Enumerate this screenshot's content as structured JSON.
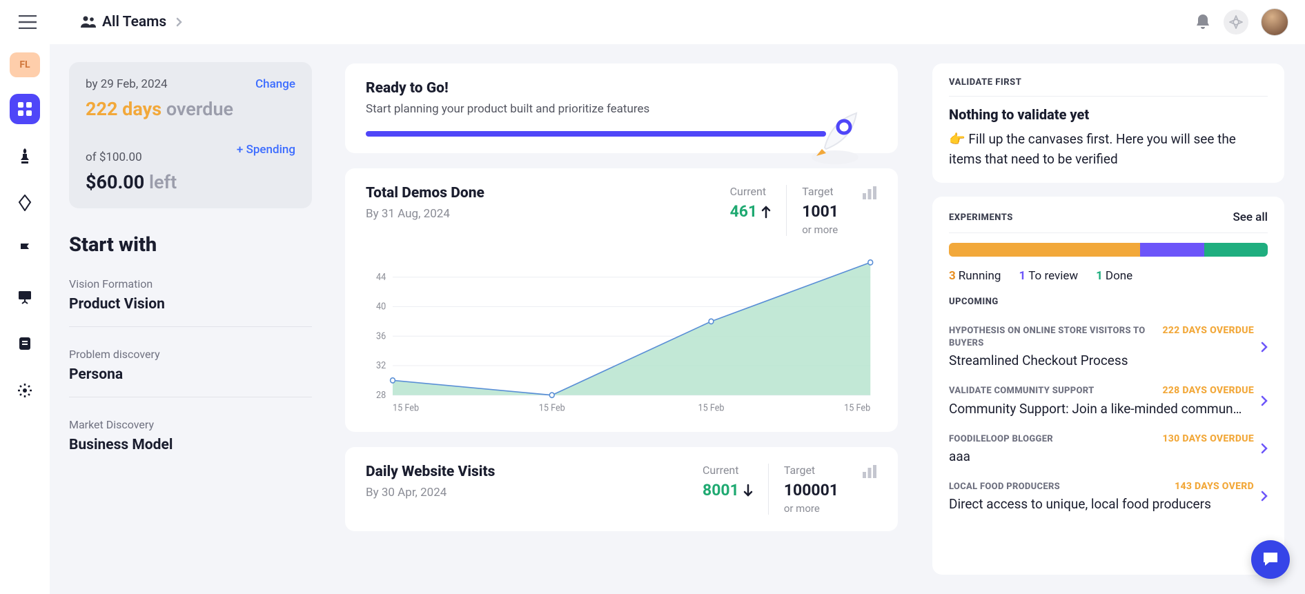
{
  "topbar": {
    "teams_label": "All Teams",
    "workspace_initials": "FL"
  },
  "budget": {
    "by_date": "by 29 Feb, 2024",
    "change_label": "Change",
    "overdue_days": "222 days ",
    "overdue_word": "overdue",
    "of_line": "of $100.00",
    "spending_label": "+ Spending",
    "left_amount": "$60.00 ",
    "left_word": "left"
  },
  "start_with": {
    "heading": "Start with",
    "groups": [
      {
        "label": "Vision Formation",
        "title": "Product Vision"
      },
      {
        "label": "Problem discovery",
        "title": "Persona"
      },
      {
        "label": "Market Discovery",
        "title": "Business Model"
      }
    ]
  },
  "ready": {
    "title": "Ready to Go!",
    "subtitle": "Start planning your product built and prioritize features"
  },
  "metric1": {
    "title": "Total Demos Done",
    "by": "By 31 Aug, 2024",
    "current_label": "Current",
    "current_value": "461",
    "target_label": "Target",
    "target_value": "1001",
    "target_note": "or more"
  },
  "metric2": {
    "title": "Daily Website Visits",
    "by": "By 30 Apr, 2024",
    "current_label": "Current",
    "current_value": "8001",
    "target_label": "Target",
    "target_value": "100001",
    "target_note": "or more"
  },
  "validate": {
    "section": "VALIDATE FIRST",
    "title": "Nothing to validate yet",
    "body": "👉 Fill up the canvases first. Here you will see the items that need to be verified"
  },
  "experiments": {
    "section": "EXPERIMENTS",
    "see_all": "See all",
    "segments": [
      {
        "color": "#f2a83a",
        "pct": 60
      },
      {
        "color": "#6c55f9",
        "pct": 20
      },
      {
        "color": "#1fae7f",
        "pct": 20
      }
    ],
    "legend": [
      {
        "n": "3",
        "label": "Running",
        "cls": "n-orange"
      },
      {
        "n": "1",
        "label": "To review",
        "cls": "n-purple"
      },
      {
        "n": "1",
        "label": "Done",
        "cls": "n-green"
      }
    ],
    "upcoming_label": "UPCOMING",
    "upcoming": [
      {
        "cat": "HYPOTHESIS ON ONLINE STORE VISITORS TO BUYERS",
        "due": "222 DAYS OVERDUE",
        "title": "Streamlined Checkout Process"
      },
      {
        "cat": "VALIDATE COMMUNITY SUPPORT",
        "due": "228 DAYS OVERDUE",
        "title": "Community Support: Join a like-minded commun…"
      },
      {
        "cat": "FOODILELOOP BLOGGER",
        "due": "130 DAYS OVERDUE",
        "title": "aaa"
      },
      {
        "cat": "LOCAL FOOD PRODUCERS",
        "due": "143 DAYS OVERD",
        "title": "Direct access to unique, local food producers"
      }
    ]
  },
  "chart_data": {
    "type": "area",
    "title": "Total Demos Done",
    "xlabel": "",
    "ylabel": "",
    "ylim": [
      28,
      46
    ],
    "yticks": [
      28,
      32,
      36,
      40,
      44
    ],
    "categories": [
      "15 Feb",
      "15 Feb",
      "15 Feb",
      "15 Feb"
    ],
    "values": [
      30,
      28,
      38,
      46
    ]
  }
}
